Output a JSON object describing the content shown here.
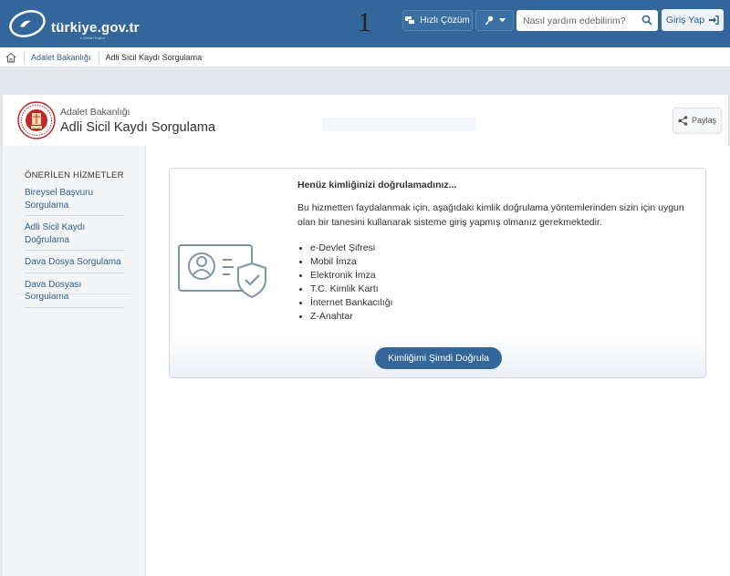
{
  "header": {
    "logo_text": "türkiye.gov.tr",
    "logo_subtext": "e-Devlet Kapısı",
    "page_number": "1",
    "quick_solution_label": "Hızlı Çözüm",
    "search_placeholder": "Nasıl yardım edebilirim?",
    "login_label": "Giriş Yap"
  },
  "breadcrumb": {
    "items": [
      "Adalet Bakanlığı",
      "Adli Sicil Kaydı Sorgulama"
    ]
  },
  "title_card": {
    "organization": "Adalet Bakanlığı",
    "service_title": "Adli Sicil Kaydı Sorgulama",
    "share_label": "Paylaş"
  },
  "sidebar": {
    "title": "ÖNERİLEN HİZMETLER",
    "items": [
      {
        "label": "Bireysel Başvuru Sorgulama"
      },
      {
        "label": "Adli Sicil Kaydı Doğrulama"
      },
      {
        "label": "Dava Dosya Sorgulama"
      },
      {
        "label": "Dava Dosyası Sorgulama"
      }
    ]
  },
  "main": {
    "heading": "Henüz kimliğinizi doğrulamadınız...",
    "description": "Bu hizmetten faydalanmak için, aşağıdaki kimlik doğrulama yöntemlerinden sizin için uygun olan bir tanesini kullanarak sisteme giriş yapmış olmanız gerekmektedir.",
    "methods": [
      "e-Devlet Şifresi",
      "Mobil İmza",
      "Elektronik İmza",
      "T.C. Kimlik Kartı",
      "İnternet Bankacılığı",
      "Z-Anahtar"
    ],
    "verify_button_label": "Kimliğimi Şimdi Doğrula"
  },
  "colors": {
    "header_bg": "#33669b",
    "accent": "#33669b",
    "link": "#2f5d8c",
    "page_bg": "#e4e8ec"
  }
}
